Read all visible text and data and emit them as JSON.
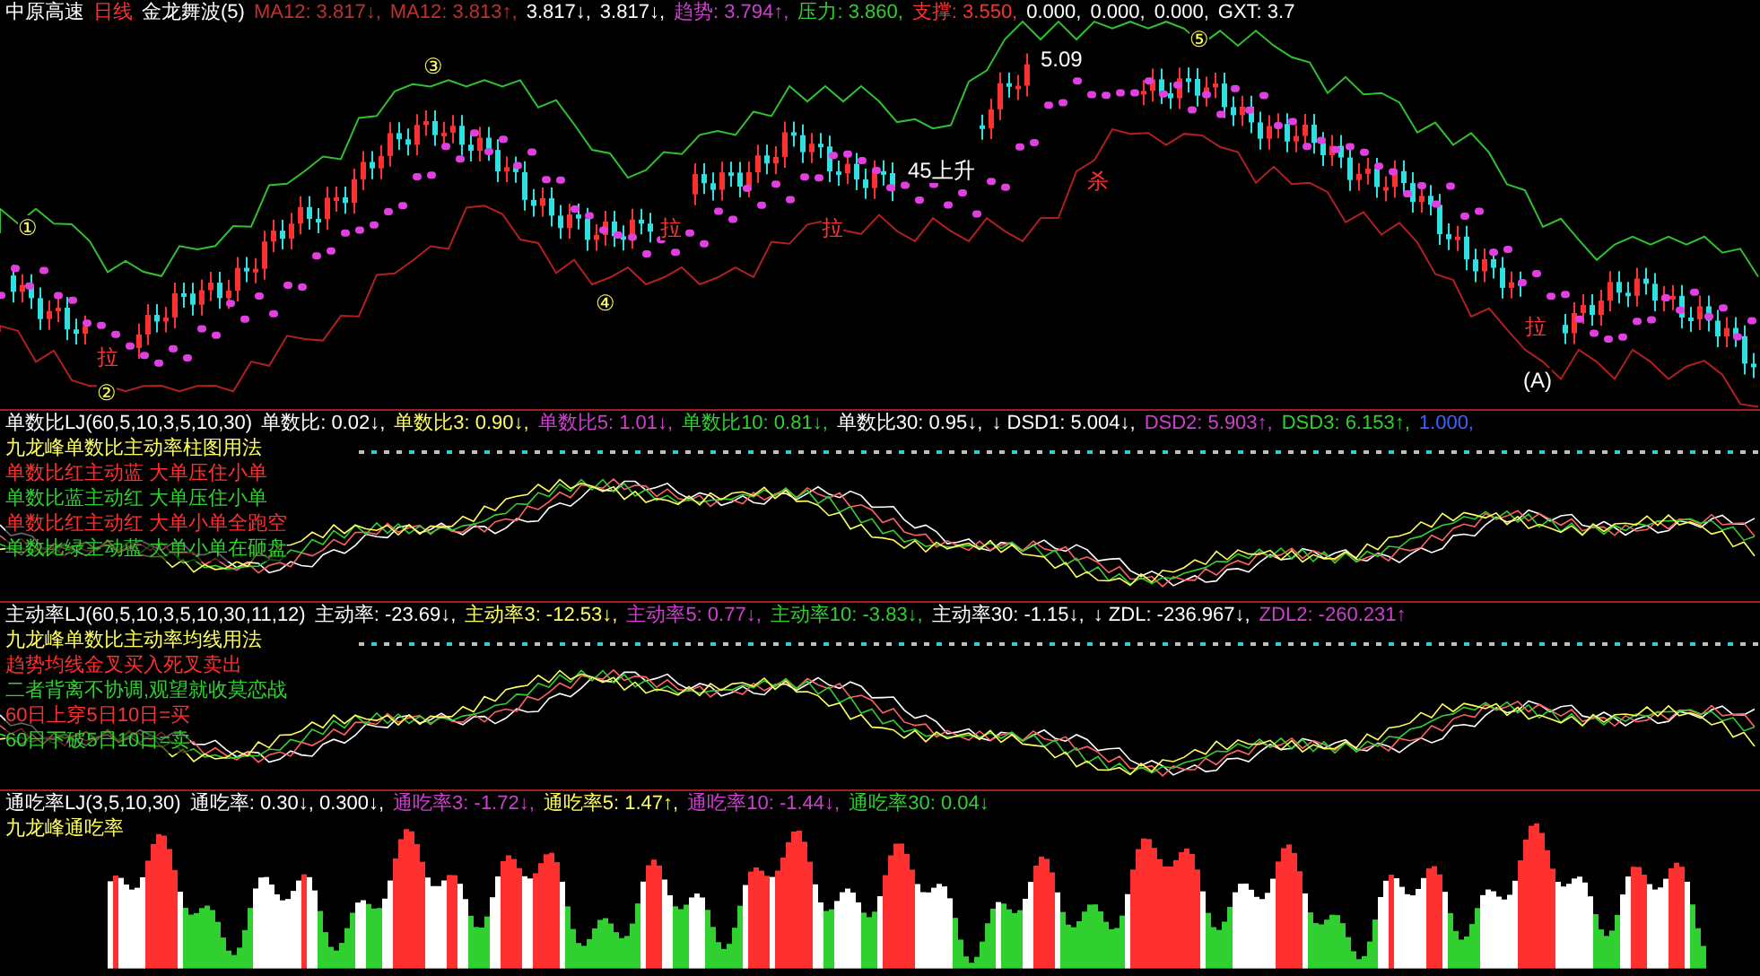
{
  "panes": [
    {
      "kind": "candles",
      "header": [
        {
          "text": "中原高速",
          "color": "#ffffff"
        },
        {
          "text": "日线",
          "color": "#ff3030"
        },
        {
          "text": "金龙舞波(5)",
          "color": "#ffffff"
        },
        {
          "text": "MA12: 3.817↓,",
          "color": "#c03030"
        },
        {
          "text": "MA12: 3.813↑,",
          "color": "#c03030"
        },
        {
          "text": "3.817↓,",
          "color": "#ffffff"
        },
        {
          "text": "3.817↓,",
          "color": "#ffffff"
        },
        {
          "text": "趋势: 3.794↑,",
          "color": "#d040d0"
        },
        {
          "text": "压力: 3.860,",
          "color": "#30d030"
        },
        {
          "text": "支撑: 3.550,",
          "color": "#ff3030"
        },
        {
          "text": "0.000,",
          "color": "#ffffff"
        },
        {
          "text": "0.000,",
          "color": "#ffffff"
        },
        {
          "text": "0.000,",
          "color": "#ffffff"
        },
        {
          "text": "GXT: 3.7",
          "color": "#ffffff"
        }
      ],
      "annotations": [
        {
          "text": "①",
          "color": "#ffff60"
        },
        {
          "text": "②",
          "color": "#ffff60"
        },
        {
          "text": "③",
          "color": "#ffff60"
        },
        {
          "text": "④",
          "color": "#ffff60"
        },
        {
          "text": "⑤",
          "color": "#ffff60"
        },
        {
          "text": "5.09",
          "color": "#ffffff"
        },
        {
          "text": "45上升",
          "color": "#ffffff"
        },
        {
          "text": "(A)",
          "color": "#ffffff"
        },
        {
          "text": "拉",
          "color": "#ff3030"
        },
        {
          "text": "拉",
          "color": "#ff3030"
        },
        {
          "text": "拉",
          "color": "#ff3030"
        },
        {
          "text": "杀",
          "color": "#ff3030"
        },
        {
          "text": "拉",
          "color": "#ff3030"
        }
      ]
    },
    {
      "kind": "lines",
      "header": [
        {
          "text": "单数比LJ(60,5,10,3,5,10,30)",
          "color": "#ffffff"
        },
        {
          "text": "单数比: 0.02↓,",
          "color": "#ffffff"
        },
        {
          "text": "单数比3: 0.90↓,",
          "color": "#ffff60"
        },
        {
          "text": "单数比5: 1.01↓,",
          "color": "#d040d0"
        },
        {
          "text": "单数比10: 0.81↓,",
          "color": "#30d030"
        },
        {
          "text": "单数比30: 0.95↓,",
          "color": "#ffffff"
        },
        {
          "text": "↓ DSD1: 5.004↓,",
          "color": "#ffffff"
        },
        {
          "text": "DSD2: 5.903↑,",
          "color": "#d040d0"
        },
        {
          "text": "DSD3: 6.153↑,",
          "color": "#30d030"
        },
        {
          "text": "1.000,",
          "color": "#4060ff"
        }
      ],
      "notes": [
        {
          "text": "九龙峰单数比主动率柱图用法",
          "color": "#ffff60"
        },
        {
          "text": "单数比红主动蓝 大单压住小单",
          "color": "#ff3030"
        },
        {
          "text": "单数比蓝主动红 大单压住小单",
          "color": "#30d030"
        },
        {
          "text": "单数比红主动红 大单小单全跑空",
          "color": "#ff3030"
        },
        {
          "text": "单数比绿主动蓝 大单小单在砸盘",
          "color": "#30d030"
        }
      ]
    },
    {
      "kind": "lines",
      "header": [
        {
          "text": "主动率LJ(60,5,10,3,5,10,30,11,12)",
          "color": "#ffffff"
        },
        {
          "text": "主动率: -23.69↓,",
          "color": "#ffffff"
        },
        {
          "text": "主动率3: -12.53↓,",
          "color": "#ffff60"
        },
        {
          "text": "主动率5: 0.77↓,",
          "color": "#d040d0"
        },
        {
          "text": "主动率10: -3.83↓,",
          "color": "#30d030"
        },
        {
          "text": "主动率30: -1.15↓,",
          "color": "#ffffff"
        },
        {
          "text": "↓ ZDL: -236.967↓,",
          "color": "#ffffff"
        },
        {
          "text": "ZDL2: -260.231↑",
          "color": "#d040d0"
        }
      ],
      "notes": [
        {
          "text": "九龙峰单数比主动率均线用法",
          "color": "#ffff60"
        },
        {
          "text": "趋势均线金叉买入死叉卖出",
          "color": "#ff3030"
        },
        {
          "text": "二者背离不协调,观望就收莫恋战",
          "color": "#30d030"
        },
        {
          "text": "60日上穿5日10日=买",
          "color": "#ff3030"
        },
        {
          "text": "60日下破5日10日=卖",
          "color": "#30d030"
        }
      ]
    },
    {
      "kind": "histogram",
      "header": [
        {
          "text": "通吃率LJ(3,5,10,30)",
          "color": "#ffffff"
        },
        {
          "text": "通吃率: 0.30↓, 0.300↓,",
          "color": "#ffffff"
        },
        {
          "text": "通吃率3: -1.72↓,",
          "color": "#d040d0"
        },
        {
          "text": "通吃率5: 1.47↑,",
          "color": "#ffff60"
        },
        {
          "text": "通吃率10: -1.44↓,",
          "color": "#d040d0"
        },
        {
          "text": "通吃率30: 0.04↓",
          "color": "#30d030"
        }
      ],
      "notes": [
        {
          "text": "九龙峰通吃率",
          "color": "#ffff60"
        }
      ]
    }
  ]
}
